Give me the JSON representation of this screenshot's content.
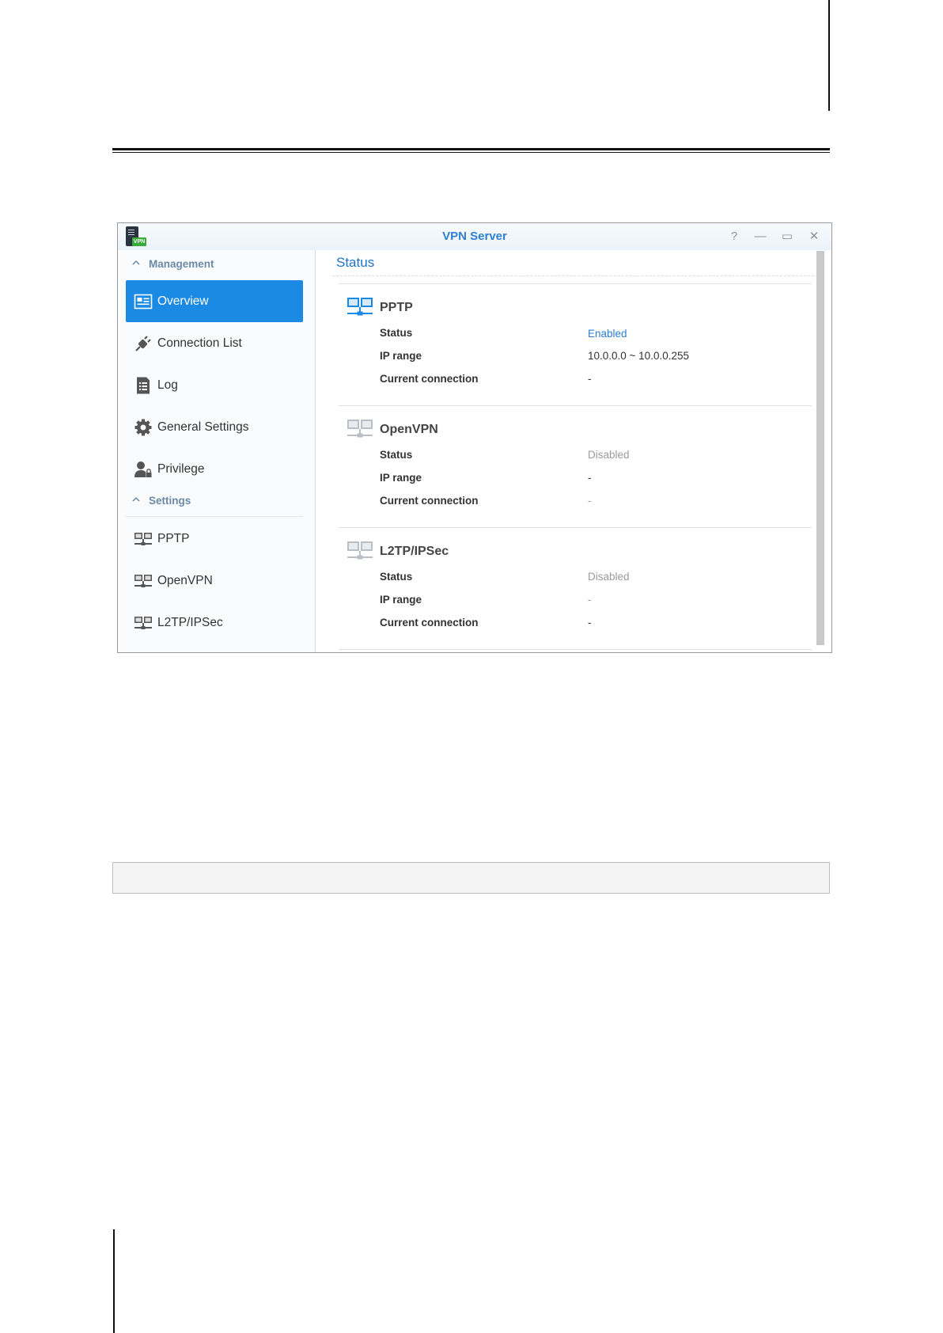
{
  "window": {
    "title": "VPN Server",
    "app_badge": "VPN",
    "controls": {
      "help": "?",
      "minimize": "—",
      "maximize": "▭",
      "close": "✕"
    }
  },
  "sidebar": {
    "groups": [
      {
        "label": "Management"
      },
      {
        "label": "Settings"
      }
    ],
    "items": [
      {
        "label": "Overview"
      },
      {
        "label": "Connection List"
      },
      {
        "label": "Log"
      },
      {
        "label": "General Settings"
      },
      {
        "label": "Privilege"
      },
      {
        "label": "PPTP"
      },
      {
        "label": "OpenVPN"
      },
      {
        "label": "L2TP/IPSec"
      }
    ]
  },
  "main": {
    "title": "Status",
    "sections": [
      {
        "name": "PPTP",
        "rows": [
          {
            "label": "Status",
            "value": "Enabled"
          },
          {
            "label": "IP range",
            "value": "10.0.0.0 ~ 10.0.0.255"
          },
          {
            "label": "Current connection",
            "value": "-"
          }
        ]
      },
      {
        "name": "OpenVPN",
        "rows": [
          {
            "label": "Status",
            "value": "Disabled"
          },
          {
            "label": "IP range",
            "value": "-"
          },
          {
            "label": "Current connection",
            "value": "-"
          }
        ]
      },
      {
        "name": "L2TP/IPSec",
        "rows": [
          {
            "label": "Status",
            "value": "Disabled"
          },
          {
            "label": "IP range",
            "value": "-"
          },
          {
            "label": "Current connection",
            "value": "-"
          }
        ]
      }
    ]
  },
  "colors": {
    "accent": "#1a8ae4",
    "title_blue": "#2f7fd0",
    "enabled": "#2a7fcf",
    "disabled": "#9a9a9a",
    "group_label": "#6b8aa7"
  }
}
